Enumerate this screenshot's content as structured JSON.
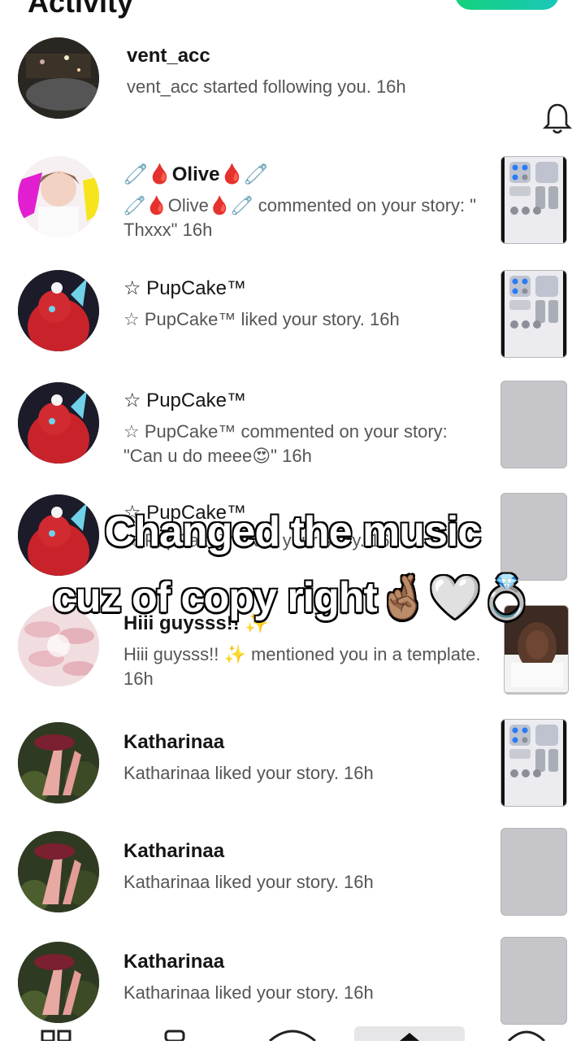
{
  "header": {
    "title": "Activity"
  },
  "notifications": [
    {
      "username": "vent_acc",
      "message": "vent_acc started following you. 16h",
      "has_bell": true
    },
    {
      "username": "🧷🩸Olive🩸🧷",
      "message": "🧷🩸Olive🩸🧷 commented on your story: \" Thxxx\" 16h",
      "thumb": "control-center"
    },
    {
      "username": "☆ PupCake™",
      "message": "☆ PupCake™ liked your story. 16h",
      "thumb": "control-center"
    },
    {
      "username": "☆ PupCake™",
      "message": "☆ PupCake™ commented on your story: \"Can u do meee😍\" 16h",
      "thumb": "blank"
    },
    {
      "username": "☆ PupCake™",
      "message": "☆ PupCake™ liked your story. 16h",
      "thumb": "blank"
    },
    {
      "username": "Hiii guysss!! ✨",
      "message": "Hiii guysss!! ✨ mentioned you in a template. 16h",
      "thumb": "photo"
    },
    {
      "username": "Katharinaa",
      "message": "Katharinaa liked your story. 16h",
      "thumb": "control-center"
    },
    {
      "username": "Katharinaa",
      "message": "Katharinaa liked your story. 16h",
      "thumb": "blank"
    },
    {
      "username": "Katharinaa",
      "message": "Katharinaa liked your story. 16h",
      "thumb": "blank"
    }
  ],
  "overlay": {
    "line1": "Changed the music",
    "line2": "cuz of copy right🤞🏽🤍💍"
  },
  "colors": {
    "accent": "#14d27c",
    "thumb_gray": "#c6c6ca"
  }
}
